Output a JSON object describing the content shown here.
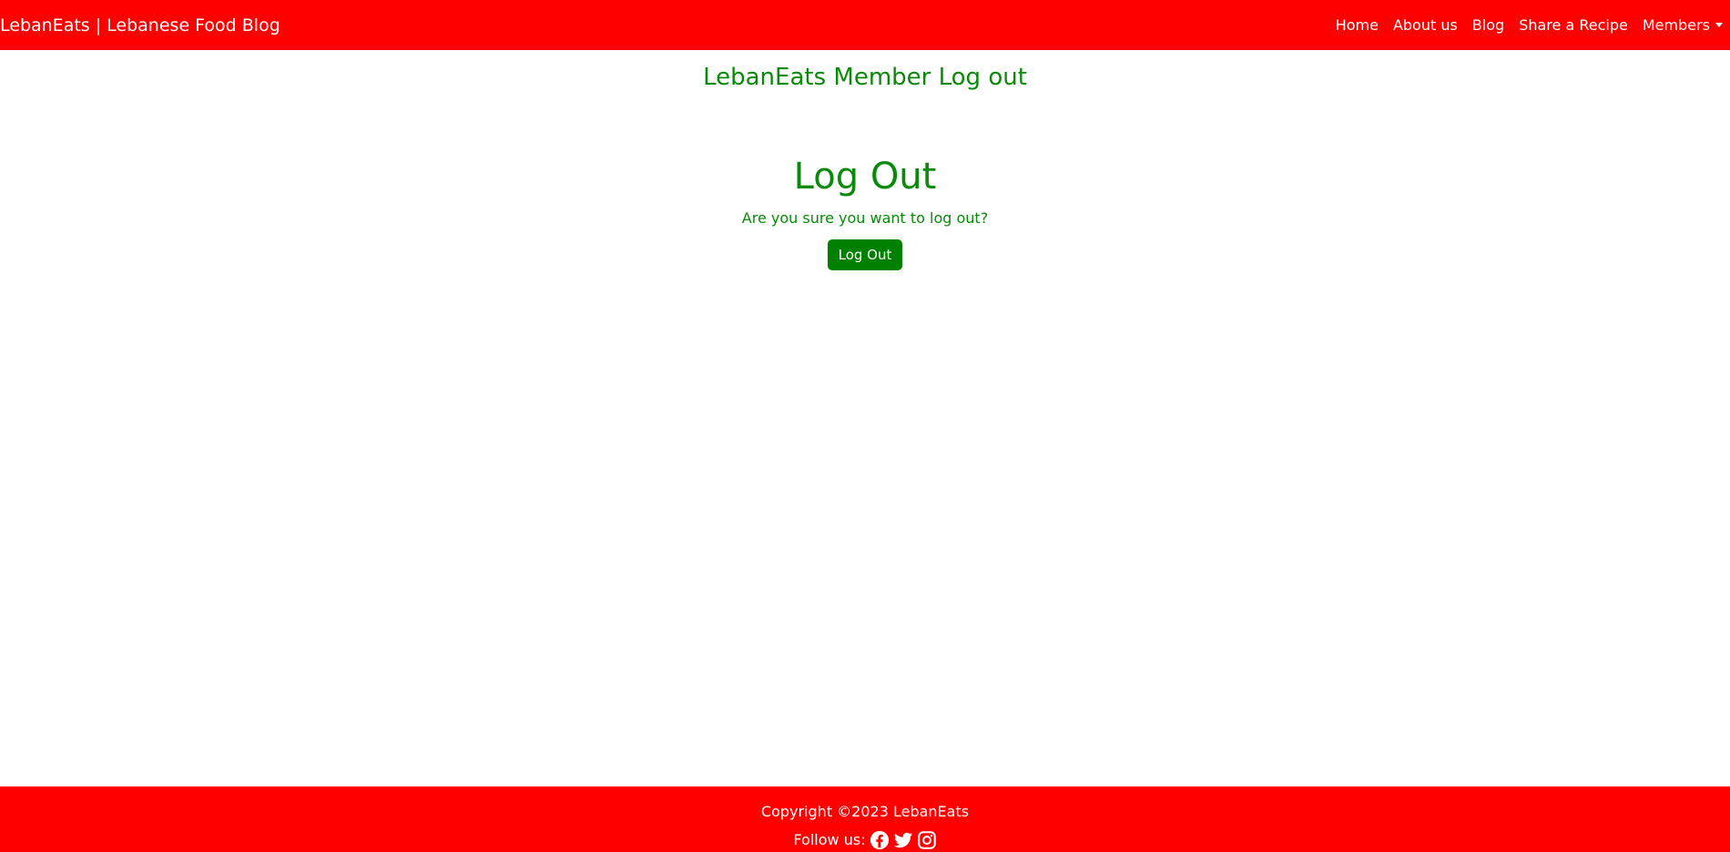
{
  "navbar": {
    "brand": "LebanEats | Lebanese Food Blog",
    "links": [
      {
        "label": "Home"
      },
      {
        "label": "About us"
      },
      {
        "label": "Blog"
      },
      {
        "label": "Share a Recipe"
      },
      {
        "label": "Members"
      }
    ],
    "background_color": "#ff0000"
  },
  "page": {
    "heading": "LebanEats Member Log out"
  },
  "logout": {
    "title": "Log Out",
    "prompt": "Are you sure you want to log out?",
    "button_label": "Log Out",
    "accent_color": "#008000"
  },
  "footer": {
    "copyright": "Copyright ©2023 LebanEats",
    "follow_label": "Follow us:",
    "social_icons": [
      "facebook-icon",
      "twitter-icon",
      "instagram-icon"
    ]
  }
}
